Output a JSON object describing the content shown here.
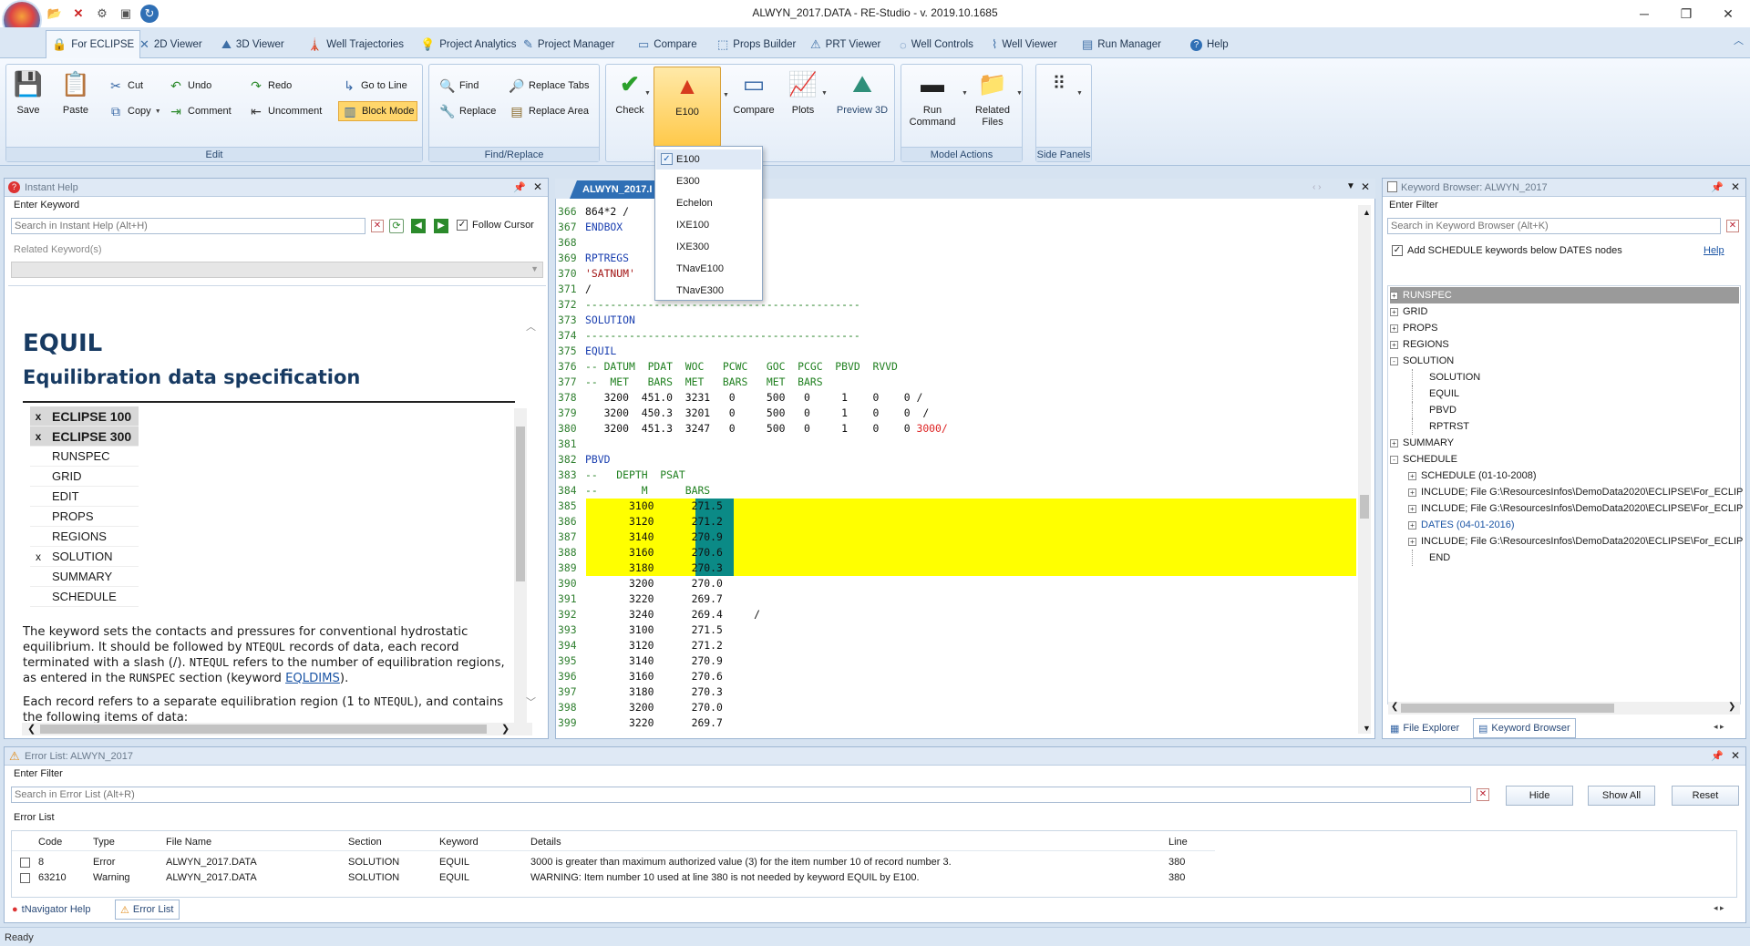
{
  "window": {
    "title": "ALWYN_2017.DATA - RE-Studio - v. 2019.10.1685"
  },
  "tabs": [
    {
      "label": "For ECLIPSE",
      "icon": "eclipse-icon",
      "active": true
    },
    {
      "label": "2D Viewer",
      "icon": "2d-viewer-icon"
    },
    {
      "label": "3D Viewer",
      "icon": "3d-viewer-icon"
    },
    {
      "label": "Well Trajectories",
      "icon": "well-trajectories-icon"
    },
    {
      "label": "Project Analytics",
      "icon": "project-analytics-icon"
    },
    {
      "label": "Project Manager",
      "icon": "project-manager-icon"
    },
    {
      "label": "Compare",
      "icon": "compare-icon"
    },
    {
      "label": "Props Builder",
      "icon": "props-builder-icon"
    },
    {
      "label": "PRT Viewer",
      "icon": "prt-viewer-icon"
    },
    {
      "label": "Well Controls",
      "icon": "well-controls-icon"
    },
    {
      "label": "Well Viewer",
      "icon": "well-viewer-icon"
    },
    {
      "label": "Run Manager",
      "icon": "run-manager-icon"
    },
    {
      "label": "Help",
      "icon": "help-icon"
    }
  ],
  "ribbon": {
    "edit": {
      "label": "Edit",
      "save": "Save",
      "paste": "Paste",
      "cut": "Cut",
      "copy": "Copy",
      "undo": "Undo",
      "redo": "Redo",
      "comment": "Comment",
      "uncomment": "Uncomment",
      "goto": "Go to Line",
      "block": "Block Mode"
    },
    "find": {
      "label": "Find/Replace",
      "find": "Find",
      "replace": "Replace",
      "replace_tabs": "Replace Tabs",
      "replace_area": "Replace Area"
    },
    "check": {
      "check": "Check",
      "e100": "E100",
      "compare": "Compare",
      "plots": "Plots",
      "preview": "Preview 3D"
    },
    "model": {
      "label": "Model Actions",
      "run1": "Run",
      "run2": "Command",
      "rel1": "Related",
      "rel2": "Files"
    },
    "side": {
      "label": "Side Panels"
    }
  },
  "solver_menu": [
    "E100",
    "E300",
    "Echelon",
    "IXE100",
    "IXE300",
    "TNavE100",
    "TNavE300"
  ],
  "instant_help": {
    "title": "Instant Help",
    "enter_keyword": "Enter Keyword",
    "search_placeholder": "Search in Instant Help (Alt+H)",
    "follow_cursor": "Follow Cursor",
    "related": "Related Keyword(s)",
    "keyword": "EQUIL",
    "subtitle": "Equilibration data specification",
    "sections": [
      {
        "mark": "x",
        "name": "ECLIPSE 100",
        "bold": true
      },
      {
        "mark": "x",
        "name": "ECLIPSE 300",
        "bold": true
      },
      {
        "mark": "",
        "name": "RUNSPEC"
      },
      {
        "mark": "",
        "name": "GRID"
      },
      {
        "mark": "",
        "name": "EDIT"
      },
      {
        "mark": "",
        "name": "PROPS"
      },
      {
        "mark": "",
        "name": "REGIONS"
      },
      {
        "mark": "x",
        "name": "SOLUTION"
      },
      {
        "mark": "",
        "name": "SUMMARY"
      },
      {
        "mark": "",
        "name": "SCHEDULE"
      }
    ],
    "p1a": "The keyword sets the contacts and pressures for conventional hydrostatic",
    "p1b": "equilibrium. It should be followed by ",
    "p1c": "NTEQUL",
    "p1d": " records of data, each record",
    "p1e": "terminated with a slash (/). ",
    "p1f": "NTEQUL",
    "p1g": " refers to the number of equilibration regions,",
    "p1h": "as entered in the ",
    "p1i": "RUNSPEC",
    "p1j": " section (keyword ",
    "p1k": "EQLDIMS",
    "p1l": ").",
    "p2a": "Each record refers to a separate equilibration region (1 to ",
    "p2b": "NTEQUL",
    "p2c": "), and contains",
    "p2d": "the following items of data:"
  },
  "editor": {
    "tab": "ALWYN_2017.I",
    "lines": [
      {
        "n": "366",
        "t": "864*2 /"
      },
      {
        "n": "367",
        "t": "ENDBOX",
        "c": "kw"
      },
      {
        "n": "368",
        "t": ""
      },
      {
        "n": "369",
        "t": "RPTREGS",
        "c": "kw"
      },
      {
        "n": "370",
        "t": "'SATNUM'",
        "c": "str"
      },
      {
        "n": "371",
        "t": "/"
      },
      {
        "n": "372",
        "t": "--------------------------------------------",
        "c": "cm"
      },
      {
        "n": "373",
        "t": "SOLUTION",
        "c": "kw"
      },
      {
        "n": "374",
        "t": "--------------------------------------------",
        "c": "cm"
      },
      {
        "n": "375",
        "t": "EQUIL",
        "c": "kw"
      },
      {
        "n": "376",
        "t": "-- DATUM  PDAT  WOC   PCWC   GOC  PCGC  PBVD  RVVD",
        "c": "cm"
      },
      {
        "n": "377",
        "t": "--  MET   BARS  MET   BARS   MET  BARS",
        "c": "cm"
      },
      {
        "n": "378",
        "t": "   3200  451.0  3231   0     500   0     1    0    0 /"
      },
      {
        "n": "379",
        "t": "   3200  450.3  3201   0     500   0     1    0    0  /"
      },
      {
        "n": "380",
        "t": "   3200  451.3  3247   0     500   0     1    0    0 ",
        "e": "3000/"
      },
      {
        "n": "381",
        "t": ""
      },
      {
        "n": "382",
        "t": "PBVD",
        "c": "kw"
      },
      {
        "n": "383",
        "t": "--   DEPTH  PSAT",
        "c": "cm"
      },
      {
        "n": "384",
        "t": "--       M      BARS",
        "c": "cm"
      },
      {
        "n": "385",
        "t": "       3100      271.5"
      },
      {
        "n": "386",
        "t": "       3120      271.2"
      },
      {
        "n": "387",
        "t": "       3140      270.9"
      },
      {
        "n": "388",
        "t": "       3160      270.6"
      },
      {
        "n": "389",
        "t": "       3180      270.3"
      },
      {
        "n": "390",
        "t": "       3200      270.0"
      },
      {
        "n": "391",
        "t": "       3220      269.7"
      },
      {
        "n": "392",
        "t": "       3240      269.4     /"
      },
      {
        "n": "393",
        "t": "       3100      271.5"
      },
      {
        "n": "394",
        "t": "       3120      271.2"
      },
      {
        "n": "395",
        "t": "       3140      270.9"
      },
      {
        "n": "396",
        "t": "       3160      270.6"
      },
      {
        "n": "397",
        "t": "       3180      270.3"
      },
      {
        "n": "398",
        "t": "       3200      270.0"
      },
      {
        "n": "399",
        "t": "       3220      269.7"
      }
    ]
  },
  "keyword_browser": {
    "title": "Keyword Browser: ALWYN_2017",
    "enter_filter": "Enter Filter",
    "search_placeholder": "Search in Keyword Browser (Alt+K)",
    "add_schedule": "Add SCHEDULE keywords below DATES nodes",
    "help": "Help",
    "tree": [
      {
        "label": "RUNSPEC",
        "level": 0,
        "exp": "+",
        "sel": true
      },
      {
        "label": "GRID",
        "level": 0,
        "exp": "+"
      },
      {
        "label": "PROPS",
        "level": 0,
        "exp": "+"
      },
      {
        "label": "REGIONS",
        "level": 0,
        "exp": "+"
      },
      {
        "label": "SOLUTION",
        "level": 0,
        "exp": "-"
      },
      {
        "label": "SOLUTION",
        "level": 1
      },
      {
        "label": "EQUIL",
        "level": 1
      },
      {
        "label": "PBVD",
        "level": 1
      },
      {
        "label": "RPTRST",
        "level": 1
      },
      {
        "label": "SUMMARY",
        "level": 0,
        "exp": "+"
      },
      {
        "label": "SCHEDULE",
        "level": 0,
        "exp": "-"
      },
      {
        "label": "SCHEDULE (01-10-2008)",
        "level": 1,
        "exp": "+"
      },
      {
        "label": "INCLUDE; File G:\\ResourcesInfos\\DemoData2020\\ECLIPSE\\For_ECLIP",
        "level": 1,
        "exp": "+"
      },
      {
        "label": "INCLUDE; File G:\\ResourcesInfos\\DemoData2020\\ECLIPSE\\For_ECLIP",
        "level": 1,
        "exp": "+"
      },
      {
        "label": "DATES (04-01-2016)",
        "level": 1,
        "exp": "+",
        "blue": true
      },
      {
        "label": "INCLUDE; File G:\\ResourcesInfos\\DemoData2020\\ECLIPSE\\For_ECLIP",
        "level": 1,
        "exp": "+"
      },
      {
        "label": "END",
        "level": 1
      }
    ],
    "tab_files": "File Explorer",
    "tab_kb": "Keyword Browser"
  },
  "error_list": {
    "title": "Error List: ALWYN_2017",
    "enter_filter": "Enter Filter",
    "search_placeholder": "Search in Error List (Alt+R)",
    "hide": "Hide",
    "show_all": "Show All",
    "reset": "Reset",
    "list_label": "Error List",
    "columns": [
      "Code",
      "Type",
      "File Name",
      "Section",
      "Keyword",
      "Details",
      "Line"
    ],
    "rows": [
      [
        "8",
        "Error",
        "ALWYN_2017.DATA",
        "SOLUTION",
        "EQUIL",
        "3000 is greater than maximum authorized value (3) for the item number 10 of record number 3.",
        "380"
      ],
      [
        "63210",
        "Warning",
        "ALWYN_2017.DATA",
        "SOLUTION",
        "EQUIL",
        "WARNING: Item number 10 used at line 380 is not needed by keyword EQUIL by E100.",
        "380"
      ]
    ],
    "tab_help": "tNavigator Help",
    "tab_errors": "Error List"
  },
  "status": {
    "text": "Ready"
  }
}
